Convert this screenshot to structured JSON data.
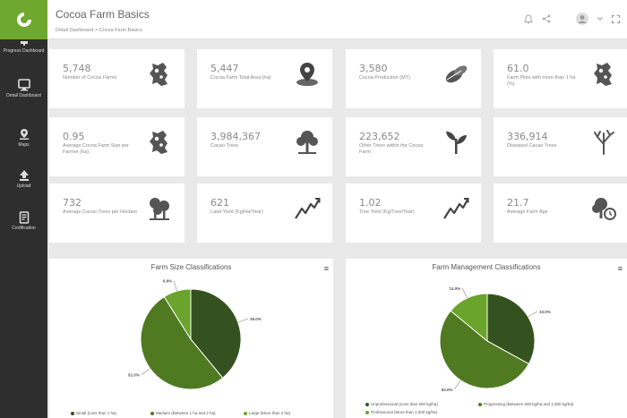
{
  "app": {
    "title": "Cocoa Farm Basics",
    "breadcrumb": "Detail Dashboard  >  Cocoa Farm Basics"
  },
  "sidebar": {
    "items": [
      {
        "label": "Progress Dashboard",
        "icon": "monitor-icon"
      },
      {
        "label": "Detail Dashboard",
        "icon": "monitor-icon"
      },
      {
        "label": "Maps",
        "icon": "map-pin-icon"
      },
      {
        "label": "Upload",
        "icon": "upload-icon"
      },
      {
        "label": "Certification",
        "icon": "certificate-icon"
      }
    ]
  },
  "cards": [
    {
      "value": "5,748",
      "label": "Number of Cocoa Farms",
      "icon": "map-icon"
    },
    {
      "value": "5,447",
      "label": "Cocoa Farm Total Area (ha)",
      "icon": "location-pin-icon"
    },
    {
      "value": "3,580",
      "label": "Cocoa Production (MT)",
      "icon": "cocoa-pod-icon"
    },
    {
      "value": "61.0",
      "label": "Farm Plots with more than 1 ha (%)",
      "icon": "map-icon"
    },
    {
      "value": "0.95",
      "label": "Average Cocoa Farm Size per Farmer (ha)",
      "icon": "map-icon"
    },
    {
      "value": "3,984,367",
      "label": "Cacao Trees",
      "icon": "tree-icon"
    },
    {
      "value": "223,652",
      "label": "Other Trees within the Cocoa Farm",
      "icon": "sprout-icon"
    },
    {
      "value": "336,914",
      "label": "Diseased Cacao Trees",
      "icon": "bare-tree-icon"
    },
    {
      "value": "732",
      "label": "Average Cacao Trees per Hectare",
      "icon": "tree-group-icon"
    },
    {
      "value": "621",
      "label": "Land Yield (Kg/Ha/Year)",
      "icon": "trend-chart-icon"
    },
    {
      "value": "1.02",
      "label": "Tree Yield (Kg/Tree/Year)",
      "icon": "trend-chart-icon"
    },
    {
      "value": "21.7",
      "label": "Average Farm Age",
      "icon": "tree-clock-icon"
    }
  ],
  "colors": {
    "brand": "#6fa82f",
    "slice_dark": "#34521f",
    "slice_mid": "#4f7a22",
    "slice_light": "#6aa42c"
  },
  "chart_data": [
    {
      "type": "pie",
      "title": "Farm Size Classifications",
      "categories": [
        "Small (Less than 1 ha)",
        "Medium (Between 1 ha and 2 ha)",
        "Large (More than 2 ha)"
      ],
      "values": [
        39.0,
        52.0,
        8.9
      ],
      "value_labels": [
        "39.0%",
        "52.0%",
        "8.9%"
      ]
    },
    {
      "type": "pie",
      "title": "Farm Management Classifications",
      "categories": [
        "Unprofessional (Less than 500 kg/ha)",
        "Progressing (Between 500 kg/ha and 1,000 kg/ha)",
        "Professional (More than 1,000 kg/ha)"
      ],
      "values": [
        33.0,
        53.0,
        14.0
      ],
      "value_labels": [
        "33.0%",
        "53.0%",
        "14.0%"
      ]
    }
  ]
}
